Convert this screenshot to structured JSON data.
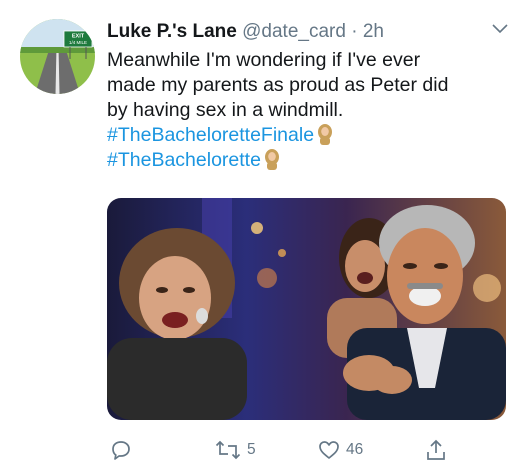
{
  "tweet": {
    "author_name": "Luke P.'s Lane",
    "handle": "@date_card",
    "time": "2h",
    "separator": "·",
    "text_lines": [
      "Meanwhile I'm wondering if I've ever",
      "made my parents as proud as Peter did",
      "by having sex in a windmill."
    ],
    "hashtags": [
      "#TheBacheloretteFinale",
      "#TheBachelorette"
    ],
    "avatar": {
      "sign_text": "EXIT",
      "sign_subtext": "1/4 MILE"
    }
  },
  "actions": {
    "reply_icon": "reply-icon",
    "retweet_icon": "retweet-icon",
    "retweet_count": "5",
    "like_icon": "heart-icon",
    "like_count": "46",
    "share_icon": "share-icon"
  },
  "colors": {
    "text": "#14171a",
    "secondary": "#657786",
    "link": "#1b95e0"
  }
}
